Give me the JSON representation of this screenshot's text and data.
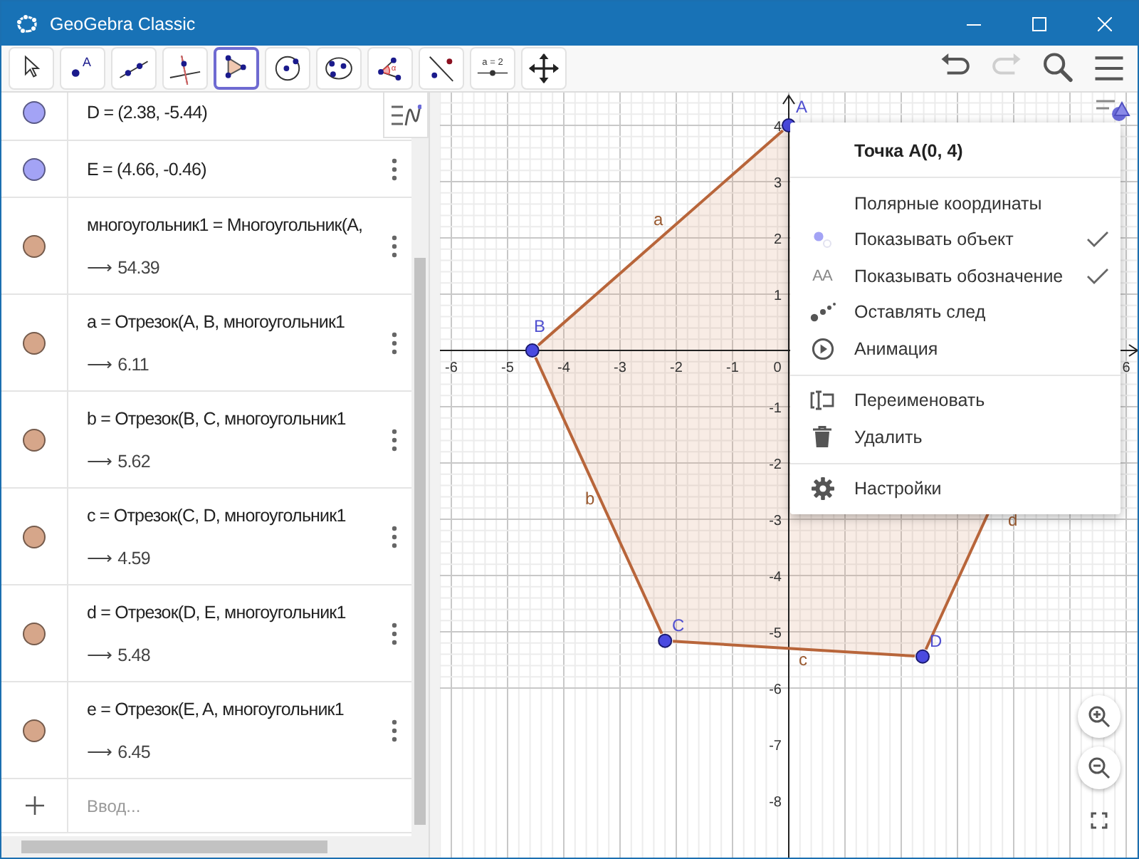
{
  "window": {
    "title": "GeoGebra Classic"
  },
  "toolbar": {
    "tools": [
      {
        "kind": "move",
        "selected": false
      },
      {
        "kind": "point",
        "selected": false,
        "icon_text": "A"
      },
      {
        "kind": "line",
        "selected": false
      },
      {
        "kind": "perpendicular",
        "selected": false
      },
      {
        "kind": "polygon",
        "selected": true
      },
      {
        "kind": "circle",
        "selected": false
      },
      {
        "kind": "conic",
        "selected": false
      },
      {
        "kind": "angle",
        "selected": false,
        "icon_text": "α"
      },
      {
        "kind": "reflect",
        "selected": false
      },
      {
        "kind": "slider",
        "selected": false,
        "icon_text": "a = 2"
      },
      {
        "kind": "pan",
        "selected": false
      }
    ],
    "actions": [
      {
        "kind": "undo",
        "disabled": false
      },
      {
        "kind": "redo",
        "disabled": true
      },
      {
        "kind": "search",
        "disabled": false
      },
      {
        "kind": "menu",
        "disabled": false
      }
    ]
  },
  "algebra": {
    "rows": [
      {
        "definition": "D = (2.38, -5.44)",
        "color": "#a3a3f5",
        "kebab": false
      },
      {
        "definition": "E = (4.66, -0.46)",
        "color": "#a3a3f5",
        "kebab": true
      },
      {
        "definition": "многоугольник1 = Многоугольник(A,",
        "value": "⟶ 54.39",
        "color": "#d6a68a",
        "kebab": true
      },
      {
        "definition": "a = Отрезок(A, B, многоугольник1",
        "value": "⟶ 6.11",
        "color": "#d6a68a",
        "kebab": true
      },
      {
        "definition": "b = Отрезок(B, C, многоугольник1",
        "value": "⟶ 5.62",
        "color": "#d6a68a",
        "kebab": true
      },
      {
        "definition": "c = Отрезок(C, D, многоугольник1",
        "value": "⟶ 4.59",
        "color": "#d6a68a",
        "kebab": true
      },
      {
        "definition": "d = Отрезок(D, E, многоугольник1",
        "value": "⟶ 5.48",
        "color": "#d6a68a",
        "kebab": true
      },
      {
        "definition": "e = Отрезок(E, A, многоугольник1",
        "value": "⟶ 6.45",
        "color": "#d6a68a",
        "kebab": true
      }
    ],
    "input": {
      "placeholder": "Ввод..."
    }
  },
  "graphics": {
    "x_ticks": [
      "-6",
      "-5",
      "-4",
      "-3",
      "-2",
      "-1",
      "0",
      "6"
    ],
    "y_ticks": [
      "4",
      "3",
      "2",
      "1",
      "-1",
      "-2",
      "-3",
      "-4",
      "-5",
      "-6",
      "-7",
      "-8"
    ],
    "point_labels": [
      "A",
      "B",
      "C",
      "D"
    ],
    "segment_labels": [
      "a",
      "b",
      "c",
      "d"
    ]
  },
  "context_menu": {
    "title": "Точка A(0, 4)",
    "groups": [
      {
        "items": [
          {
            "label": "Полярные координаты",
            "kind": "plain",
            "checked": false
          },
          {
            "label": "Показывать объект",
            "kind": "dot",
            "checked": true
          },
          {
            "label": "Показывать обозначение",
            "kind": "labels",
            "icon_text": "AA",
            "checked": true
          },
          {
            "label": "Оставлять след",
            "kind": "trace",
            "checked": false
          },
          {
            "label": "Анимация",
            "kind": "play",
            "checked": false
          }
        ]
      },
      {
        "items": [
          {
            "label": "Переименовать",
            "kind": "rename",
            "checked": false
          },
          {
            "label": "Удалить",
            "kind": "trash",
            "checked": false
          }
        ]
      },
      {
        "items": [
          {
            "label": "Настройки",
            "kind": "gear",
            "checked": false
          }
        ]
      }
    ]
  }
}
